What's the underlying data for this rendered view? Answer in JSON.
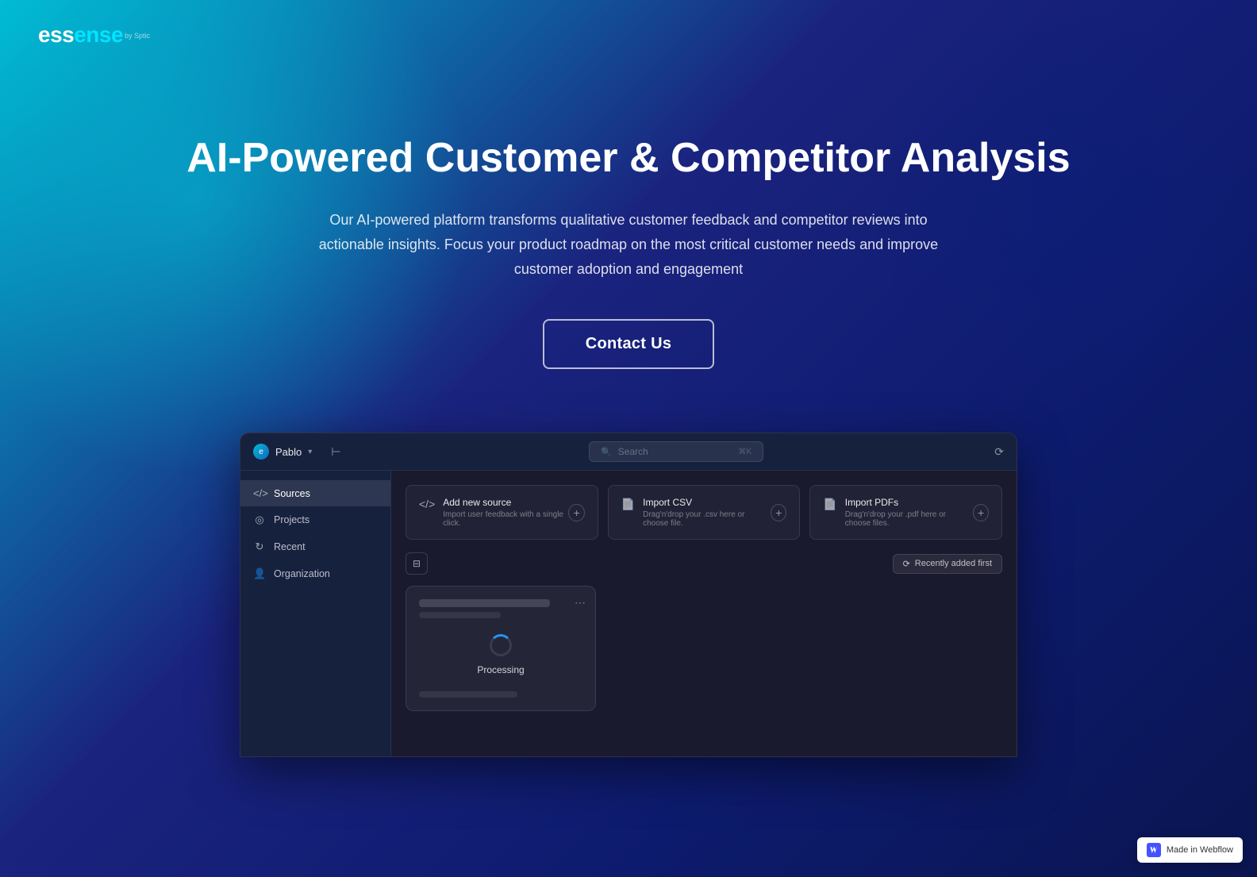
{
  "meta": {
    "title": "Essense - AI-Powered Customer & Competitor Analysis"
  },
  "header": {
    "logo": {
      "text_part1": "ess",
      "text_part2": "ense",
      "sub": "by Sptic"
    }
  },
  "hero": {
    "title": "AI-Powered Customer & Competitor Analysis",
    "description": "Our AI-powered platform transforms qualitative customer feedback and competitor reviews into actionable insights. Focus your product roadmap on the most critical customer needs and improve customer adoption and engagement",
    "cta_label": "Contact Us"
  },
  "app": {
    "titlebar": {
      "user_name": "Pablo",
      "search_placeholder": "Search...",
      "icons": [
        "←→",
        "⟳"
      ]
    },
    "sidebar": {
      "items": [
        {
          "label": "Sources",
          "icon": "</>",
          "active": true
        },
        {
          "label": "Projects",
          "icon": "◎"
        },
        {
          "label": "Recent",
          "icon": "⟳"
        },
        {
          "label": "Organization",
          "icon": "👤"
        }
      ]
    },
    "source_cards": [
      {
        "icon": "</>",
        "title": "Add new source",
        "description": "Import user feedback with a single click.",
        "add_label": "+"
      },
      {
        "icon": "📄",
        "title": "Import CSV",
        "description": "Drag'n'drop your .csv here or choose file.",
        "add_label": "+"
      },
      {
        "icon": "📄",
        "title": "Import PDFs",
        "description": "Drag'n'drop your .pdf here or choose files.",
        "add_label": "+"
      }
    ],
    "filter_row": {
      "filter_icon": "⊟",
      "sort_label": "Recently added first",
      "sort_icon": "⟳"
    },
    "processing_card": {
      "status_label": "Processing",
      "menu_icon": "⋯"
    }
  },
  "webflow_badge": {
    "text": "Made in Webflow",
    "icon": "W"
  }
}
